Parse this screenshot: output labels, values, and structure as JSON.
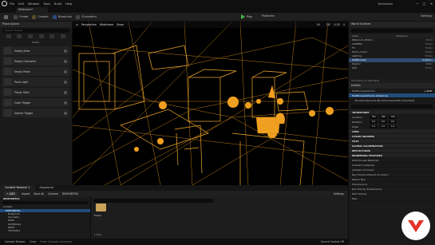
{
  "menubar": {
    "items": [
      "File",
      "Edit",
      "Window",
      "Tools",
      "Build",
      "Help"
    ],
    "project": "Demolaba"
  },
  "tab": {
    "label": "Millenium*"
  },
  "toolbar": {
    "save": "Save",
    "create": "Create",
    "content": "Content",
    "blueprints": "Blueprints",
    "cinematics": "Cinematics",
    "play": "Play",
    "platforms": "Platforms",
    "settings": "Settings"
  },
  "place_actors": {
    "title": "Place Actors",
    "search_placeholder": "Search Classes",
    "category": "BASIC",
    "items": [
      "Empty Actor",
      "Empty Character",
      "Empty Pawn",
      "Point Light",
      "Player Start",
      "Cube Trigger",
      "Sphere Trigger"
    ]
  },
  "viewport": {
    "perspective": "Perspective",
    "mode": "Wireframe",
    "show": "Show",
    "snap_grid": "10",
    "snap_rot": "10°",
    "snap_scale": "0.25",
    "cam_speed": "4",
    "colors": {
      "wire": "#f0a020",
      "bg": "#000000"
    }
  },
  "outliner": {
    "title": "World Outliner",
    "col_label": "Label",
    "col_type": "Sequence",
    "rows": [
      {
        "label": "Millenium (Editor)",
        "type": "World"
      },
      {
        "label": "CAMERA",
        "type": "Folder"
      },
      {
        "label": "FX",
        "type": "Folder"
      },
      {
        "label": "Demo_mesh",
        "type": "Folder"
      },
      {
        "label": "Lighting",
        "type": "Folder"
      },
      {
        "label": "PostProcess",
        "type": "PostProc"
      },
      {
        "label": "Skybox",
        "type": "Static"
      },
      {
        "label": "Text",
        "type": "Folder"
      }
    ],
    "footer": "113 actors (1 selected)"
  },
  "details": {
    "title": "Details",
    "actor": "PostProcessVolume",
    "add_label": "+ ADD",
    "component_root": "PostProcessVolume (Instance)",
    "component_child": "BrushComponent (BrushComponent0) (Inherited)",
    "transform": "TRANSFORM",
    "location": {
      "label": "Location",
      "x": "780",
      "y": "-360",
      "z": "780"
    },
    "rotation": {
      "label": "Rotation",
      "x": "0.0",
      "y": "0.0",
      "z": "0.0"
    },
    "scale": {
      "label": "Scale",
      "x": "1.0",
      "y": "1.0",
      "z": "1.0"
    },
    "sections": [
      "LENS",
      "COLOR GRADING",
      "FILM",
      "GLOBAL ILLUMINATION",
      "REFLECTIONS",
      "RENDERING FEATURES"
    ],
    "rendering_rows": [
      "Post Process Materials",
      "Ambient Cubemap",
      "Ambient Occlusion",
      "Ray Traced Ambient Occlusion",
      "Motion Blur",
      "Translucency",
      "Ray Tracing Translucency",
      "Path Tracing",
      "Misc"
    ]
  },
  "content_browser": {
    "tab1": "Content Browser 1",
    "tab2": "Sequencer",
    "add": "+ ADD",
    "import": "Import",
    "save_all": "Save All",
    "path1": "Content",
    "path2": "DEMOMETAS",
    "settings": "Settings",
    "tree_header": "DEMOMETAS",
    "tree": [
      "Content",
      "DEMOMETAS",
      "Blueprints",
      "Geometry",
      "MAPS",
      "MATERIALS",
      "MESH",
      "TEXTURES",
      "Movies"
    ],
    "folder_label": "Folder",
    "items_count": "1 item",
    "collections": "COLLECTIONS"
  },
  "statusbar": {
    "drawer": "Content Drawer",
    "cmd": "Cmd",
    "console_placeholder": "Enter Console Command",
    "source_control": "Source Control Off"
  }
}
